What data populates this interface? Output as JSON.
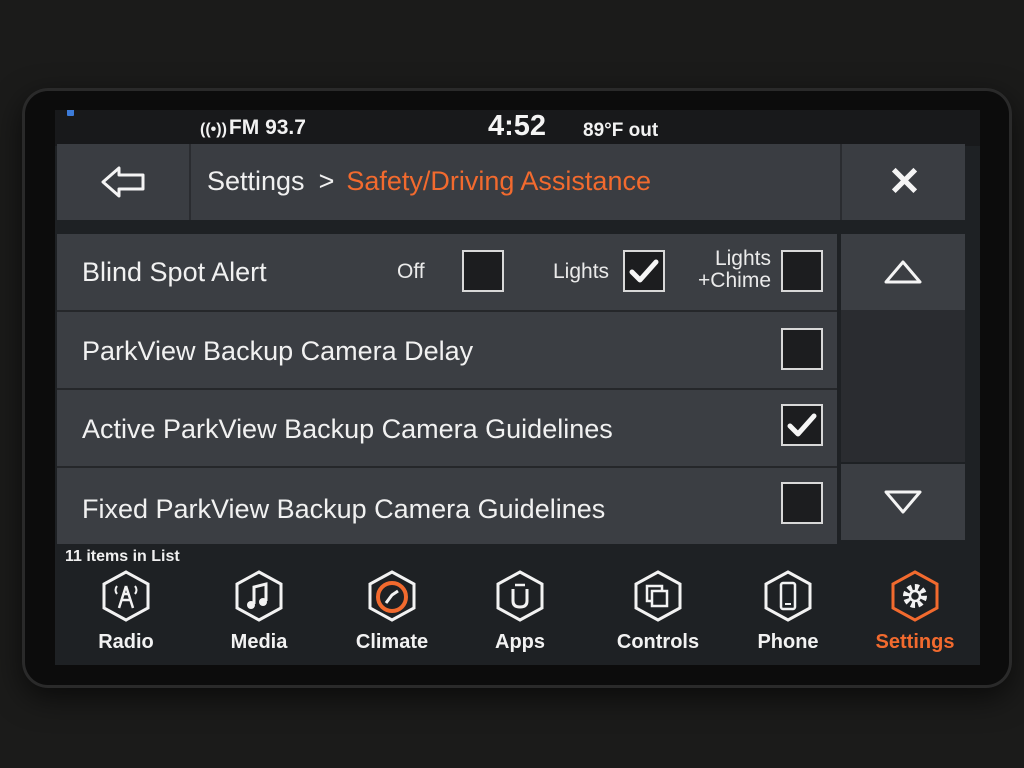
{
  "status": {
    "radio": "FM 93.7",
    "clock": "4:52",
    "temp": "89°F out"
  },
  "header": {
    "breadcrumb_root": "Settings",
    "separator": ">",
    "breadcrumb_current": "Safety/Driving Assistance"
  },
  "rows": [
    {
      "label": "Blind Spot Alert",
      "options": [
        {
          "label": "Off",
          "checked": false
        },
        {
          "label": "Lights",
          "checked": true
        },
        {
          "label": "Lights\n+Chime",
          "label_line1": "Lights",
          "label_line2": "+Chime",
          "checked": false
        }
      ]
    },
    {
      "label": "ParkView Backup Camera Delay",
      "checked": false
    },
    {
      "label": "Active ParkView Backup Camera Guidelines",
      "checked": true
    },
    {
      "label": "Fixed ParkView Backup Camera Guidelines",
      "checked": false
    }
  ],
  "list_count": "11 items in List",
  "nav": [
    {
      "label": "Radio",
      "icon": "radio-tower-icon"
    },
    {
      "label": "Media",
      "icon": "music-note-icon"
    },
    {
      "label": "Climate",
      "icon": "climate-icon"
    },
    {
      "label": "Apps",
      "icon": "apps-icon"
    },
    {
      "label": "Controls",
      "icon": "controls-icon"
    },
    {
      "label": "Phone",
      "icon": "phone-icon"
    },
    {
      "label": "Settings",
      "icon": "gear-icon",
      "active": true
    }
  ],
  "colors": {
    "accent": "#f26a2e",
    "row_bg": "#3b3e43",
    "header_bg": "#3a3d42"
  }
}
